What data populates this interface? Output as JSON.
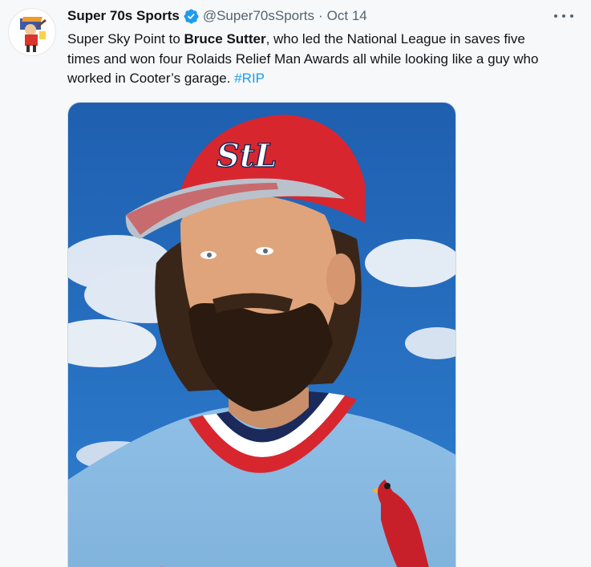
{
  "tweet": {
    "display_name": "Super 70s Sports",
    "handle": "@Super70sSports",
    "separator": "·",
    "date": "Oct 14",
    "text_part1": "Super Sky Point to ",
    "text_bold": "Bruce Sutter",
    "text_part2": ", who led the National League in saves five times and won four Rolaids Relief Man Awards all while looking like a guy who worked in Cooter’s garage. ",
    "hashtag": "#RIP"
  },
  "icons": {
    "verified": "verified-badge-icon",
    "more": "more-options-icon"
  },
  "colors": {
    "link": "#1d9bf0",
    "verified": "#1d9bf0",
    "secondary_text": "#536471"
  }
}
